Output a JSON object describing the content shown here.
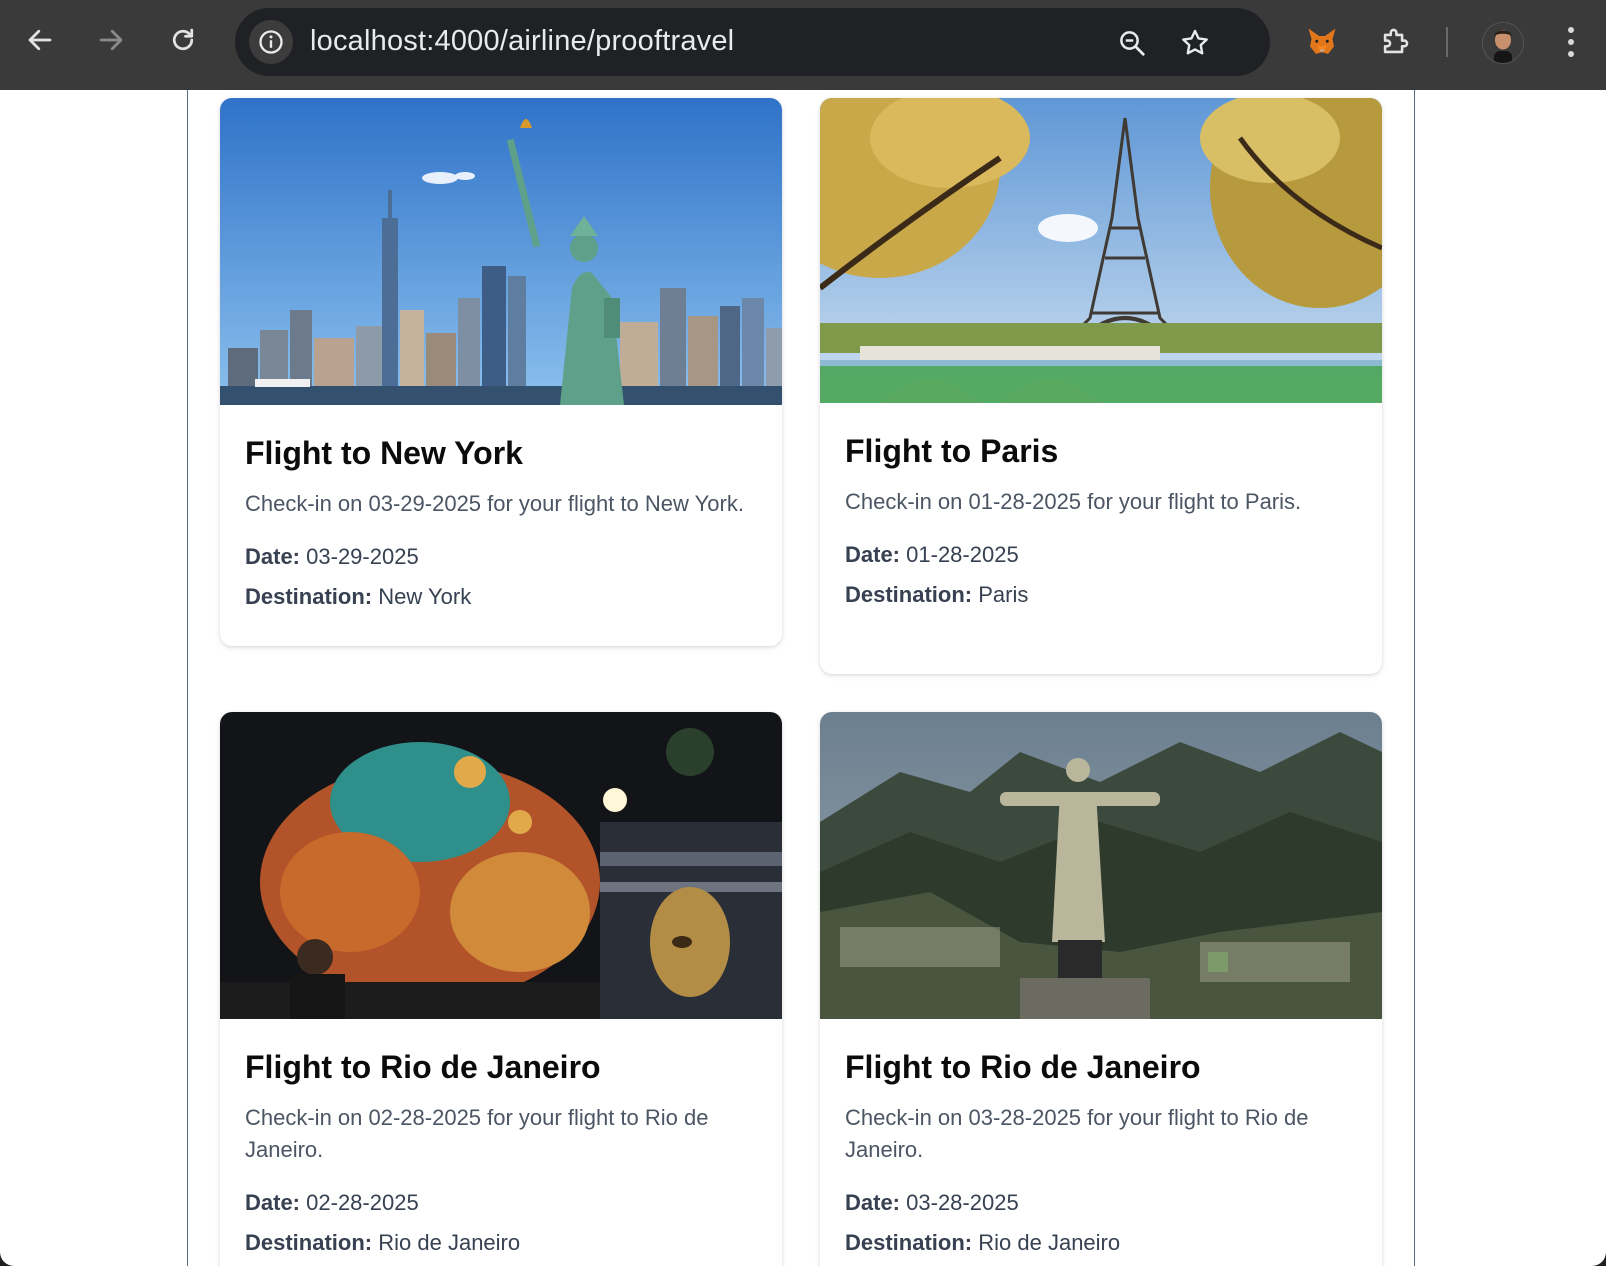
{
  "browser": {
    "url": "localhost:4000/airline/prooftravel",
    "icons": [
      "back-arrow-icon",
      "forward-arrow-icon",
      "reload-icon",
      "site-info-icon",
      "zoom-icon",
      "bookmark-star-icon",
      "metamask-fox-icon",
      "extensions-puzzle-icon",
      "profile-avatar",
      "more-menu-icon"
    ]
  },
  "labels": {
    "date": "Date:",
    "destination": "Destination:"
  },
  "cards": [
    {
      "title": "Flight to New York",
      "description": "Check-in on 03-29-2025 for your flight to New York.",
      "date": "03-29-2025",
      "destination": "New York"
    },
    {
      "title": "Flight to Paris",
      "description": "Check-in on 01-28-2025 for your flight to Paris.",
      "date": "01-28-2025",
      "destination": "Paris"
    },
    {
      "title": "Flight to Rio de Janeiro",
      "description": "Check-in on 02-28-2025 for your flight to Rio de Janeiro.",
      "date": "02-28-2025",
      "destination": "Rio de Janeiro"
    },
    {
      "title": "Flight to Rio de Janeiro",
      "description": "Check-in on 03-28-2025 for your flight to Rio de Janeiro.",
      "date": "03-28-2025",
      "destination": "Rio de Janeiro"
    }
  ]
}
